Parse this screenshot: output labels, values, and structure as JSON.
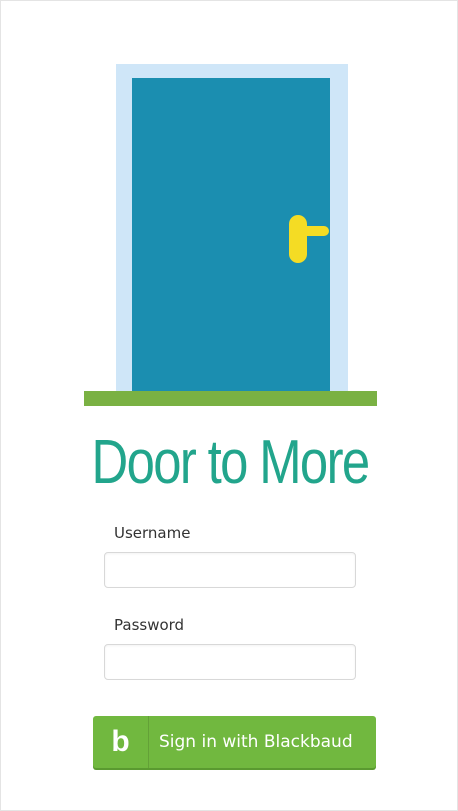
{
  "app": {
    "title": "Door to More"
  },
  "illustration": {
    "name": "door",
    "colors": {
      "frame": "#cfe6f8",
      "door": "#1b8eb0",
      "handle": "#f4dc24",
      "sill": "#7ab143"
    }
  },
  "form": {
    "username": {
      "label": "Username",
      "value": "",
      "placeholder": ""
    },
    "password": {
      "label": "Password",
      "value": "",
      "placeholder": ""
    }
  },
  "signin_button": {
    "icon": "blackbaud-b-icon",
    "icon_text": "b",
    "label": "Sign in with Blackbaud",
    "color": "#71b83f"
  },
  "colors": {
    "title": "#22a58c"
  }
}
